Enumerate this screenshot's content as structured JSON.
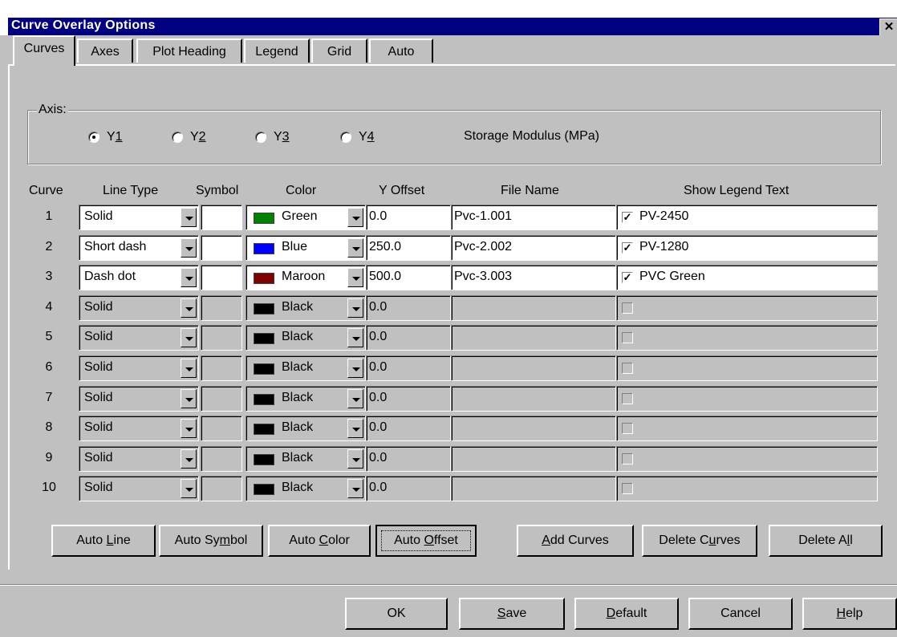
{
  "window": {
    "title": "Curve Overlay Options",
    "close_glyph": "✕"
  },
  "tabs": [
    {
      "label": "Curves"
    },
    {
      "label": "Axes"
    },
    {
      "label": "Plot Heading"
    },
    {
      "label": "Legend"
    },
    {
      "label": "Grid"
    },
    {
      "label": "Auto"
    }
  ],
  "axis_group": {
    "label": "Axis:",
    "options": [
      {
        "pre": "Y",
        "ul": "1",
        "selected": true
      },
      {
        "pre": "Y",
        "ul": "2",
        "selected": false
      },
      {
        "pre": "Y",
        "ul": "3",
        "selected": false
      },
      {
        "pre": "Y",
        "ul": "4",
        "selected": false
      }
    ],
    "axis_name": "Storage Modulus (MPa)"
  },
  "columns": {
    "curve": "Curve",
    "line_type": "Line Type",
    "symbol": "Symbol",
    "color": "Color",
    "y_offset": "Y Offset",
    "file_name": "File Name",
    "legend": "Show Legend Text"
  },
  "rows": [
    {
      "num": "1",
      "line_type": "Solid",
      "symbol": "",
      "color": "Green",
      "color_hex": "#008000",
      "y_offset": "0.0",
      "file_name": "Pvc-1.001",
      "checked": true,
      "legend": "PV-2450",
      "enabled": true
    },
    {
      "num": "2",
      "line_type": "Short dash",
      "symbol": "",
      "color": "Blue",
      "color_hex": "#0000ff",
      "y_offset": "250.0",
      "file_name": "Pvc-2.002",
      "checked": true,
      "legend": "PV-1280",
      "enabled": true
    },
    {
      "num": "3",
      "line_type": "Dash dot",
      "symbol": "",
      "color": "Maroon",
      "color_hex": "#800000",
      "y_offset": "500.0",
      "file_name": "Pvc-3.003",
      "checked": true,
      "legend": "PVC Green",
      "enabled": true
    },
    {
      "num": "4",
      "line_type": "Solid",
      "symbol": "",
      "color": "Black",
      "color_hex": "#000000",
      "y_offset": "0.0",
      "file_name": "",
      "checked": false,
      "legend": "",
      "enabled": false
    },
    {
      "num": "5",
      "line_type": "Solid",
      "symbol": "",
      "color": "Black",
      "color_hex": "#000000",
      "y_offset": "0.0",
      "file_name": "",
      "checked": false,
      "legend": "",
      "enabled": false
    },
    {
      "num": "6",
      "line_type": "Solid",
      "symbol": "",
      "color": "Black",
      "color_hex": "#000000",
      "y_offset": "0.0",
      "file_name": "",
      "checked": false,
      "legend": "",
      "enabled": false
    },
    {
      "num": "7",
      "line_type": "Solid",
      "symbol": "",
      "color": "Black",
      "color_hex": "#000000",
      "y_offset": "0.0",
      "file_name": "",
      "checked": false,
      "legend": "",
      "enabled": false
    },
    {
      "num": "8",
      "line_type": "Solid",
      "symbol": "",
      "color": "Black",
      "color_hex": "#000000",
      "y_offset": "0.0",
      "file_name": "",
      "checked": false,
      "legend": "",
      "enabled": false
    },
    {
      "num": "9",
      "line_type": "Solid",
      "symbol": "",
      "color": "Black",
      "color_hex": "#000000",
      "y_offset": "0.0",
      "file_name": "",
      "checked": false,
      "legend": "",
      "enabled": false
    },
    {
      "num": "10",
      "line_type": "Solid",
      "symbol": "",
      "color": "Black",
      "color_hex": "#000000",
      "y_offset": "0.0",
      "file_name": "",
      "checked": false,
      "legend": "",
      "enabled": false
    }
  ],
  "action_buttons": [
    {
      "pre": "Auto ",
      "ul": "L",
      "post": "ine"
    },
    {
      "pre": "Auto Sy",
      "ul": "m",
      "post": "bol"
    },
    {
      "pre": "Auto ",
      "ul": "C",
      "post": "olor"
    },
    {
      "pre": "Auto ",
      "ul": "O",
      "post": "ffset"
    },
    {
      "pre": "",
      "ul": "A",
      "post": "dd Curves"
    },
    {
      "pre": "Delete C",
      "ul": "u",
      "post": "rves"
    },
    {
      "pre": "Delete A",
      "ul": "l",
      "post": "l"
    }
  ],
  "dialog_buttons": [
    {
      "pre": "OK",
      "ul": "",
      "post": ""
    },
    {
      "pre": "",
      "ul": "S",
      "post": "ave"
    },
    {
      "pre": "",
      "ul": "D",
      "post": "efault"
    },
    {
      "pre": "Cancel",
      "ul": "",
      "post": ""
    },
    {
      "pre": "",
      "ul": "H",
      "post": "elp"
    }
  ]
}
